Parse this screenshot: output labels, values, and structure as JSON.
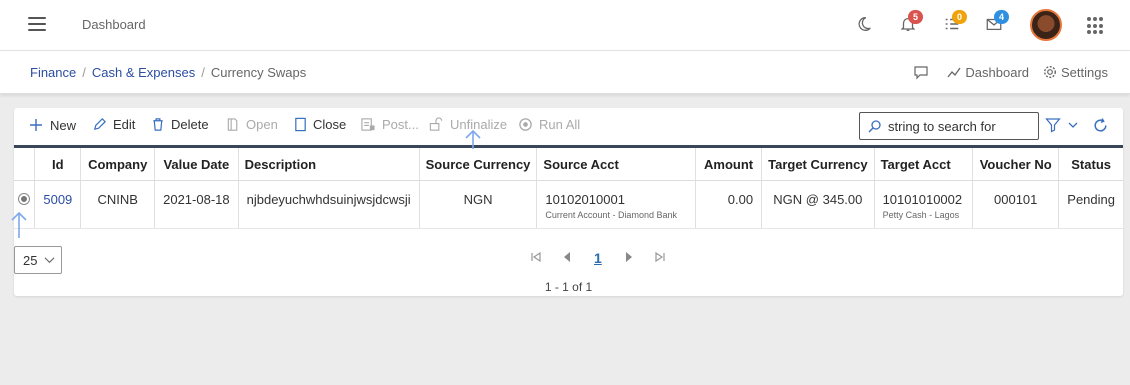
{
  "header": {
    "title": "Dashboard",
    "notifications_count": "5",
    "tasks_count": "0",
    "messages_count": "4",
    "colors": {
      "notif": "#d9534f",
      "tasks": "#f0a30a",
      "messages": "#2f8fe0"
    }
  },
  "breadcrumb": {
    "items": [
      "Finance",
      "Cash & Expenses"
    ],
    "current": "Currency Swaps",
    "sep": "/"
  },
  "crumb_actions": {
    "dashboard": "Dashboard",
    "settings": "Settings"
  },
  "toolbar": {
    "new": "New",
    "edit": "Edit",
    "delete": "Delete",
    "open": "Open",
    "close": "Close",
    "post": "Post...",
    "unfinalize": "Unfinalize",
    "run_all": "Run All",
    "search_placeholder": "string to search for"
  },
  "table": {
    "columns": [
      "Id",
      "Company",
      "Value Date",
      "Description",
      "Source Currency",
      "Source Acct",
      "Amount",
      "Target Currency",
      "Target Acct",
      "Voucher No",
      "Status"
    ],
    "rows": [
      {
        "id": "5009",
        "company": "CNINB",
        "value_date": "2021-08-18",
        "description": "njbdeyuchwhdsuinjwsjdcwsji",
        "source_currency": "NGN",
        "source_acct": "10102010001",
        "source_acct_name": "Current Account - Diamond Bank",
        "amount": "0.00",
        "target_currency": "NGN @ 345.00",
        "target_acct": "10101010002",
        "target_acct_name": "Petty Cash - Lagos",
        "voucher_no": "000101",
        "status": "Pending"
      }
    ]
  },
  "pager": {
    "page_size": "25",
    "current_page": "1",
    "info": "1 - 1 of 1"
  }
}
